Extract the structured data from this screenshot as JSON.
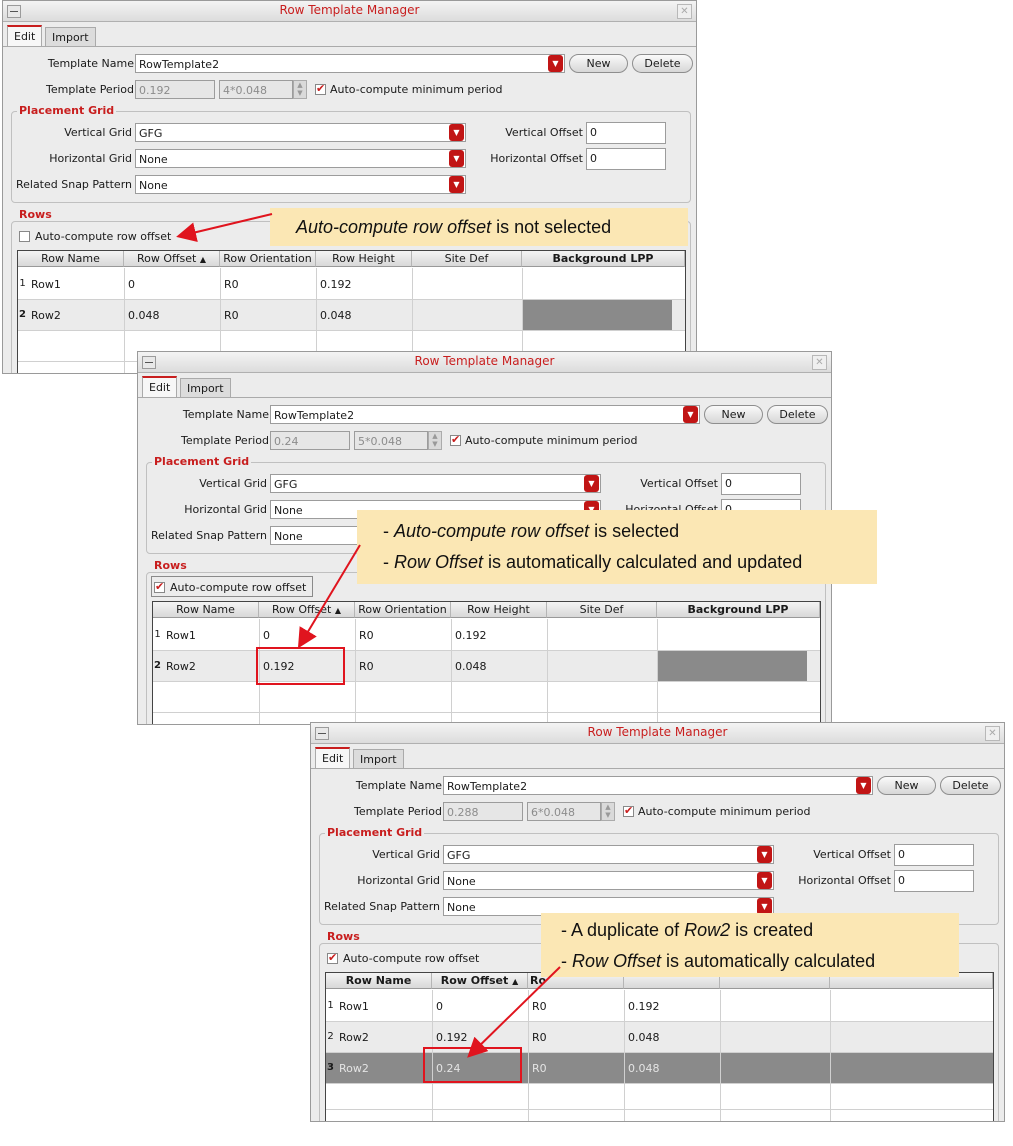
{
  "win1": {
    "title": "Row Template Manager",
    "tabs": [
      "Edit",
      "Import"
    ],
    "template_name_label": "Template Name",
    "template_name": "RowTemplate2",
    "template_period_label": "Template Period",
    "template_period": "0.192",
    "period_formula": "4*0.048",
    "autocompute_period_label": "Auto-compute minimum period",
    "new_label": "New",
    "delete_label": "Delete",
    "placement_grid_label": "Placement Grid",
    "vertical_grid_label": "Vertical Grid",
    "vertical_grid": "GFG",
    "horizontal_grid_label": "Horizontal Grid",
    "horizontal_grid": "None",
    "related_snap_label": "Related Snap Pattern",
    "related_snap": "None",
    "vertical_offset_label": "Vertical Offset",
    "vertical_offset": "0",
    "horizontal_offset_label": "Horizontal Offset",
    "horizontal_offset": "0",
    "rows_label": "Rows",
    "autocompute_row_label": "Auto-compute row offset",
    "columns": [
      "Row Name",
      "Row Offset",
      "Row Orientation",
      "Row Height",
      "Site Def",
      "Background LPP"
    ],
    "rows": [
      {
        "n": "1",
        "name": "Row1",
        "offset": "0",
        "orient": "R0",
        "height": "0.192"
      },
      {
        "n": "2",
        "name": "Row2",
        "offset": "0.048",
        "orient": "R0",
        "height": "0.048"
      }
    ]
  },
  "win2": {
    "title": "Row Template Manager",
    "tabs": [
      "Edit",
      "Import"
    ],
    "template_name_label": "Template Name",
    "template_name": "RowTemplate2",
    "template_period_label": "Template Period",
    "template_period": "0.24",
    "period_formula": "5*0.048",
    "autocompute_period_label": "Auto-compute minimum period",
    "new_label": "New",
    "delete_label": "Delete",
    "placement_grid_label": "Placement Grid",
    "vertical_grid_label": "Vertical Grid",
    "vertical_grid": "GFG",
    "horizontal_grid_label": "Horizontal Grid",
    "horizontal_grid": "None",
    "related_snap_label": "Related Snap Pattern",
    "related_snap": "None",
    "vertical_offset_label": "Vertical Offset",
    "vertical_offset": "0",
    "horizontal_offset_label": "Horizontal Offset",
    "horizontal_offset": "0",
    "rows_label": "Rows",
    "autocompute_row_label": "Auto-compute row offset",
    "columns": [
      "Row Name",
      "Row Offset",
      "Row Orientation",
      "Row Height",
      "Site Def",
      "Background LPP"
    ],
    "rows": [
      {
        "n": "1",
        "name": "Row1",
        "offset": "0",
        "orient": "R0",
        "height": "0.192"
      },
      {
        "n": "2",
        "name": "Row2",
        "offset": "0.192",
        "orient": "R0",
        "height": "0.048"
      }
    ]
  },
  "win3": {
    "title": "Row Template Manager",
    "tabs": [
      "Edit",
      "Import"
    ],
    "template_name_label": "Template Name",
    "template_name": "RowTemplate2",
    "template_period_label": "Template Period",
    "template_period": "0.288",
    "period_formula": "6*0.048",
    "autocompute_period_label": "Auto-compute minimum period",
    "new_label": "New",
    "delete_label": "Delete",
    "placement_grid_label": "Placement Grid",
    "vertical_grid_label": "Vertical Grid",
    "vertical_grid": "GFG",
    "horizontal_grid_label": "Horizontal Grid",
    "horizontal_grid": "None",
    "related_snap_label": "Related Snap Pattern",
    "related_snap": "None",
    "vertical_offset_label": "Vertical Offset",
    "vertical_offset": "0",
    "horizontal_offset_label": "Horizontal Offset",
    "horizontal_offset": "0",
    "rows_label": "Rows",
    "autocompute_row_label": "Auto-compute row offset",
    "columns": [
      "Row Name",
      "Row Offset",
      "Ro"
    ],
    "rows": [
      {
        "n": "1",
        "name": "Row1",
        "offset": "0",
        "orient": "R0",
        "height": "0.192"
      },
      {
        "n": "2",
        "name": "Row2",
        "offset": "0.192",
        "orient": "R0",
        "height": "0.048"
      },
      {
        "n": "3",
        "name": "Row2",
        "offset": "0.24",
        "orient": "R0",
        "height": "0.048"
      }
    ]
  },
  "callouts": {
    "c1_em": "Auto-compute row offset",
    "c1_rest": " is not selected",
    "c2_l1_pre": "- ",
    "c2_l1_em": "Auto-compute row offset",
    "c2_l1_rest": " is selected",
    "c2_l2_pre": "- ",
    "c2_l2_em": "Row Offset",
    "c2_l2_rest": " is automatically calculated and updated",
    "c3_l1_pre": "- A duplicate of ",
    "c3_l1_em": "Row2",
    "c3_l1_rest": " is created",
    "c3_l2_pre": "- ",
    "c3_l2_em": "Row Offset",
    "c3_l2_rest": " is automatically calculated"
  },
  "colors": {
    "accent_red": "#c81e1e",
    "callout_bg": "#fbe7b4",
    "selected_row": "#8a8a8a"
  }
}
